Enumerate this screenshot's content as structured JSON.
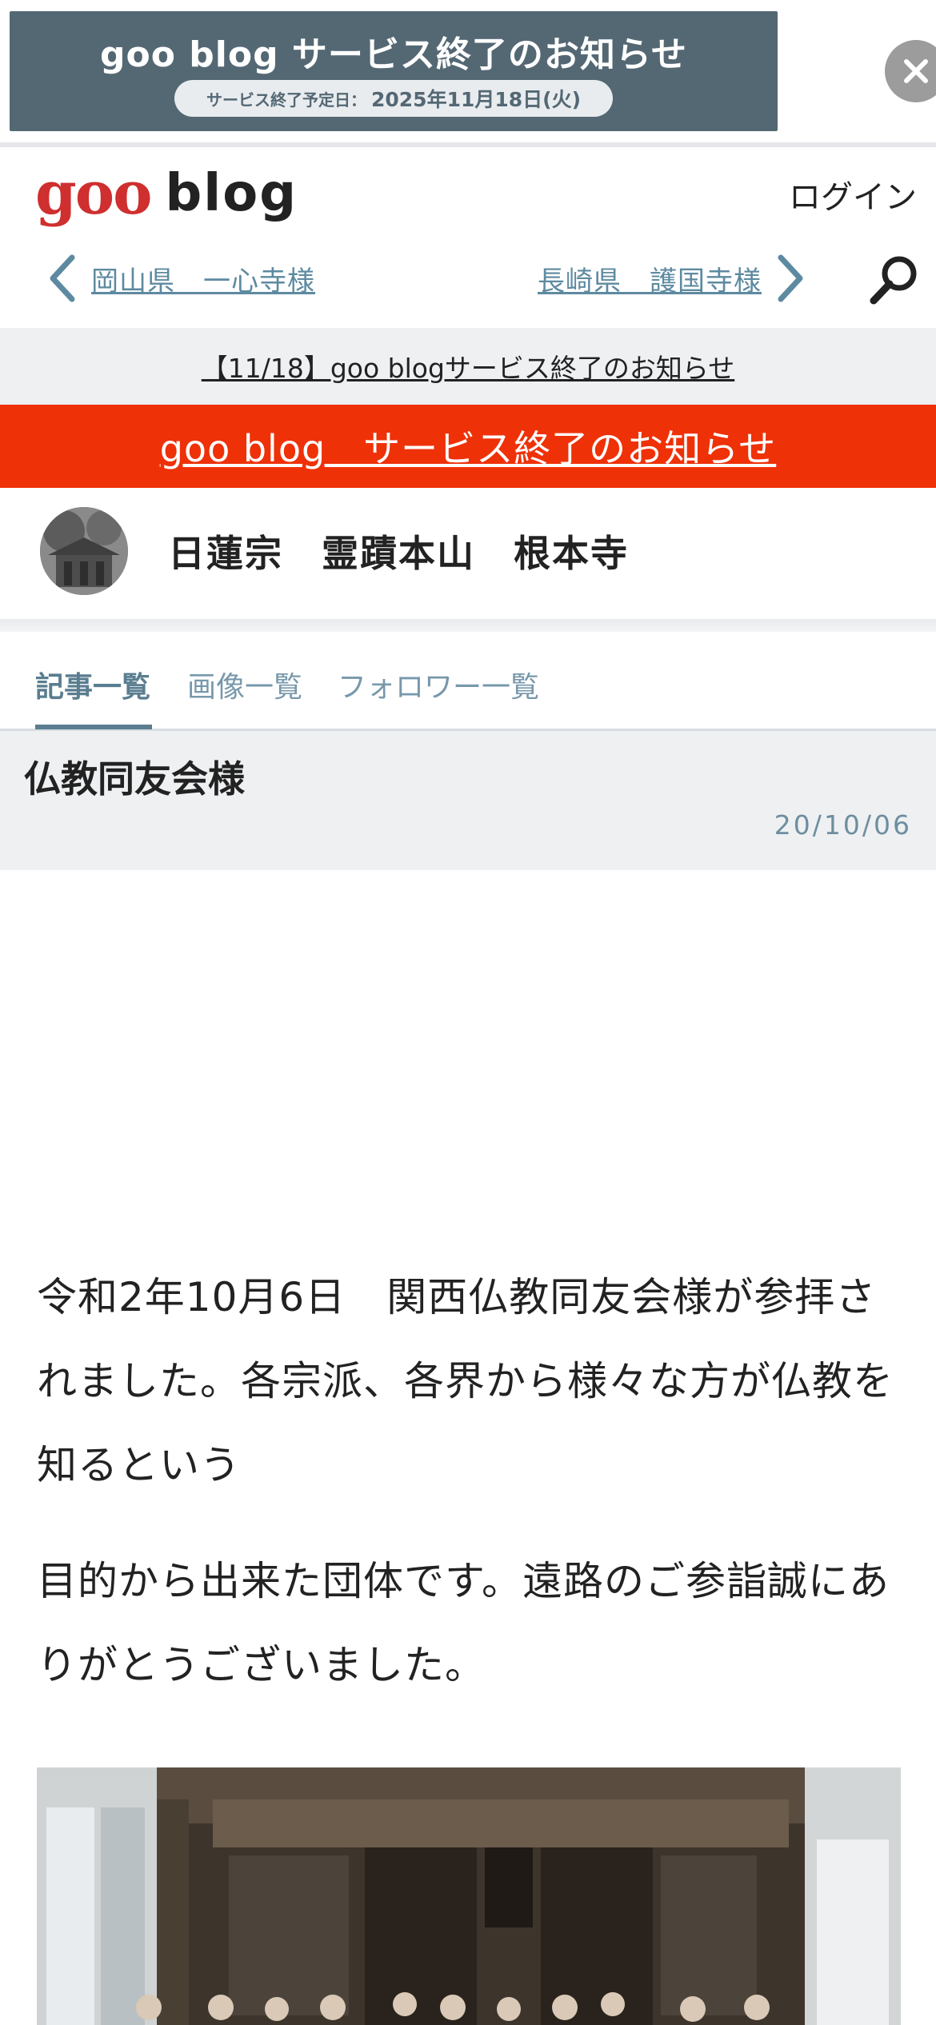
{
  "ad": {
    "title": "goo blog サービス終了のお知らせ",
    "end_label": "サービス終了予定日：",
    "end_date": "2025年11月18日(火)"
  },
  "header": {
    "logo_goo": "goo",
    "logo_blog": "blog",
    "login": "ログイン",
    "prev_post": "岡山県　一心寺様",
    "next_post": "長崎県　護国寺様"
  },
  "notices": {
    "gray": "【11/18】goo blogサービス終了のお知らせ",
    "red": "goo blog　サービス終了のお知らせ"
  },
  "blog": {
    "name": "日蓮宗　霊蹟本山　根本寺"
  },
  "tabs": [
    {
      "label": "記事一覧",
      "active": true
    },
    {
      "label": "画像一覧",
      "active": false
    },
    {
      "label": "フォロワー一覧",
      "active": false
    }
  ],
  "article": {
    "title": "仏教同友会様",
    "date": "20/10/06",
    "paragraphs": [
      "令和2年10月6日　関西仏教同友会様が参拝されました。各宗派、各界から様々な方が仏教を知るという",
      "目的から出来た団体です。遠路のご参詣誠にありがとうございました。"
    ]
  },
  "colors": {
    "ad_bg": "#546874",
    "notice_red": "#ef3108",
    "link": "#5d8aa0",
    "logo_red": "#cf2f2f"
  },
  "icons": [
    "close-icon",
    "chevron-left-icon",
    "chevron-right-icon",
    "search-icon"
  ]
}
